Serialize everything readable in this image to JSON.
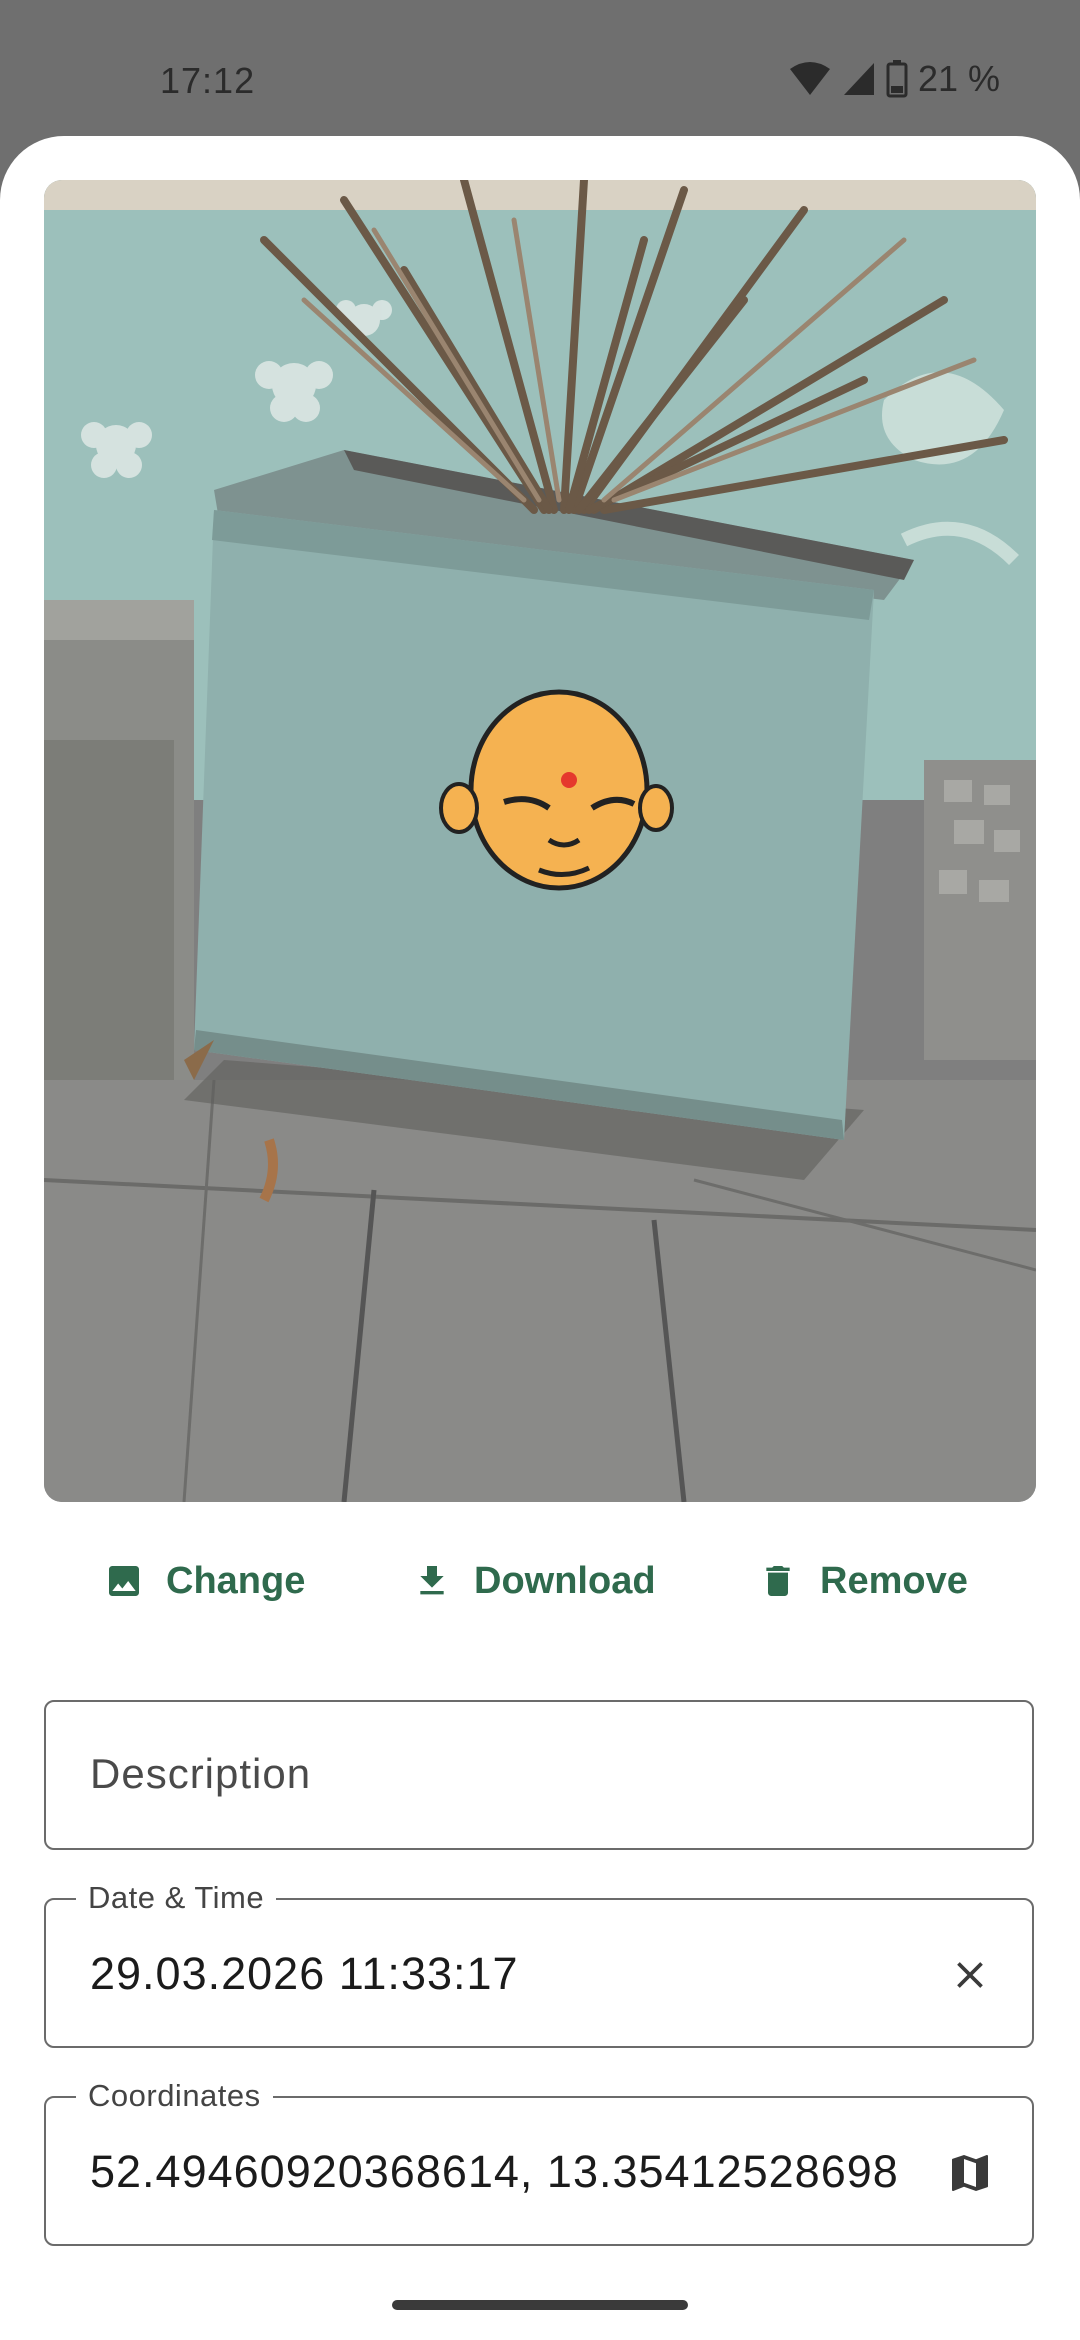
{
  "status_bar": {
    "time": "17:12",
    "battery_text": "21 %",
    "icons": [
      "wifi-icon",
      "signal-icon",
      "battery-icon"
    ]
  },
  "photo": {
    "description_icon": "street-art-stencil-face-on-planter"
  },
  "actions": {
    "change_label": "Change",
    "change_icon": "image-icon",
    "download_label": "Download",
    "download_icon": "download-icon",
    "remove_label": "Remove",
    "remove_icon": "trash-icon"
  },
  "fields": {
    "description": {
      "placeholder": "Description",
      "value": ""
    },
    "datetime": {
      "label": "Date & Time",
      "value": "29.03.2026 11:33:17",
      "trailing_icon": "close-icon"
    },
    "coordinates": {
      "label": "Coordinates",
      "value": "52.4946092036861​4, 13.35412528698",
      "trailing_icon": "map-icon"
    }
  },
  "colors": {
    "accent": "#2f6a4d",
    "sheet_bg": "#ffffff",
    "scrim": "#6f6f6f",
    "outline": "#6b6b6b"
  }
}
